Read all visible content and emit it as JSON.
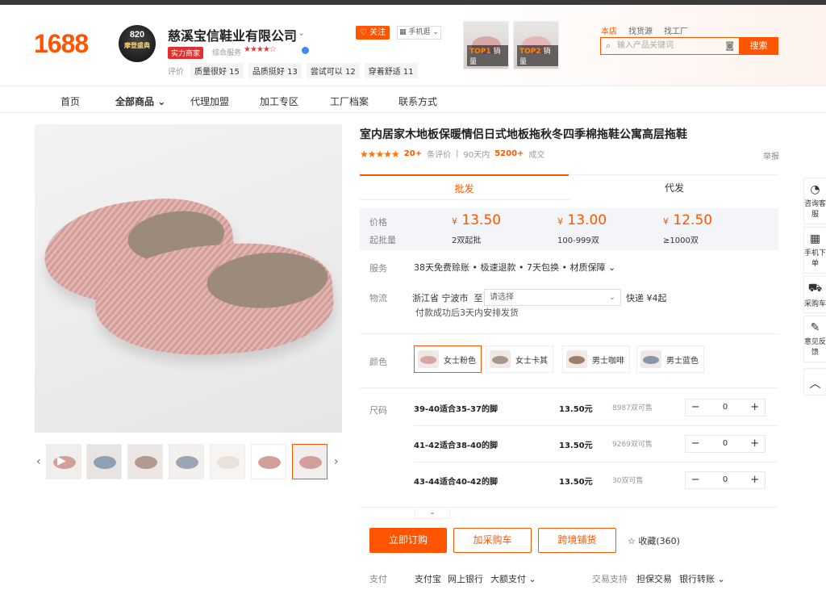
{
  "header": {
    "logo": "1688",
    "avatar_line1": "820",
    "avatar_line2": "摩登盛典",
    "shop_name": "慈溪宝信鞋业有限公司",
    "badge": "实力商家",
    "rating_label": "综合服务",
    "rating_stars": "★★★★☆",
    "tags_label": "评价",
    "tags": [
      "质量很好 15",
      "品质挺好 13",
      "尝试可以 12",
      "穿着舒适 11"
    ],
    "follow": "关注",
    "mobile": "手机逛",
    "top_products": [
      {
        "rank": "TOP1",
        "label": "销量"
      },
      {
        "rank": "TOP2",
        "label": "销量"
      }
    ],
    "search_tabs": [
      "本店",
      "找货源",
      "找工厂"
    ],
    "search_placeholder": "输入产品关键词",
    "search_button": "搜索"
  },
  "nav": [
    "首页",
    "全部商品",
    "代理加盟",
    "加工专区",
    "工厂档案",
    "联系方式"
  ],
  "product": {
    "title": "室内居家木地板保暖情侣日式地板拖秋冬四季棉拖鞋公寓高层拖鞋",
    "stars": "★★★★★",
    "review_count": "20+",
    "review_label": "条评价",
    "sales_period": "90天内",
    "sales_count": "5200+",
    "sales_label": "成交",
    "report": "举报",
    "tab_wholesale": "批发",
    "tab_dropship": "代发",
    "price_label": "价格",
    "qty_label": "起批量",
    "currency": "¥",
    "tiers": [
      {
        "price": "13.50",
        "qty": "2双起批"
      },
      {
        "price": "13.00",
        "qty": "100-999双"
      },
      {
        "price": "12.50",
        "qty": "≥1000双"
      }
    ],
    "service_label": "服务",
    "service": "38天免费赊账 • 极速退款 • 7天包换 • 材质保障",
    "logistics_label": "物流",
    "ship_from": "浙江省 宁波市",
    "ship_to_label": "至",
    "ship_to_placeholder": "请选择",
    "shipping": "快递  ¥4起",
    "ship_note": "付款成功后3天内安排发货",
    "color_label": "颜色",
    "colors": [
      "女士粉色",
      "女士卡其",
      "男士咖啡",
      "男士蓝色"
    ],
    "size_label": "尺码",
    "sizes": [
      {
        "name": "39-40适合35-37的脚",
        "price": "13.50元",
        "stock": "8987双可售",
        "qty": "0"
      },
      {
        "name": "41-42适合38-40的脚",
        "price": "13.50元",
        "stock": "9269双可售",
        "qty": "0"
      },
      {
        "name": "43-44适合40-42的脚",
        "price": "13.50元",
        "stock": "30双可售",
        "qty": "0"
      }
    ],
    "buy_now": "立即订购",
    "add_cart": "加采购车",
    "cross_border": "跨境铺货",
    "favorite": "收藏(360)",
    "pay_label": "支付",
    "pay_methods": [
      "支付宝",
      "网上银行",
      "大额支付"
    ],
    "trade_label": "交易支持",
    "trade_items": [
      "担保交易",
      "银行转账"
    ]
  },
  "sidebar": [
    {
      "label": "咨询客服",
      "icon": "chat-icon"
    },
    {
      "label": "手机下单",
      "icon": "qrcode-icon"
    },
    {
      "label": "采购车",
      "icon": "cart-icon"
    },
    {
      "label": "意见反馈",
      "icon": "edit-icon"
    }
  ],
  "colors": {
    "accent": "#ff5500",
    "price_panel_bg": "#f4f5f9"
  }
}
